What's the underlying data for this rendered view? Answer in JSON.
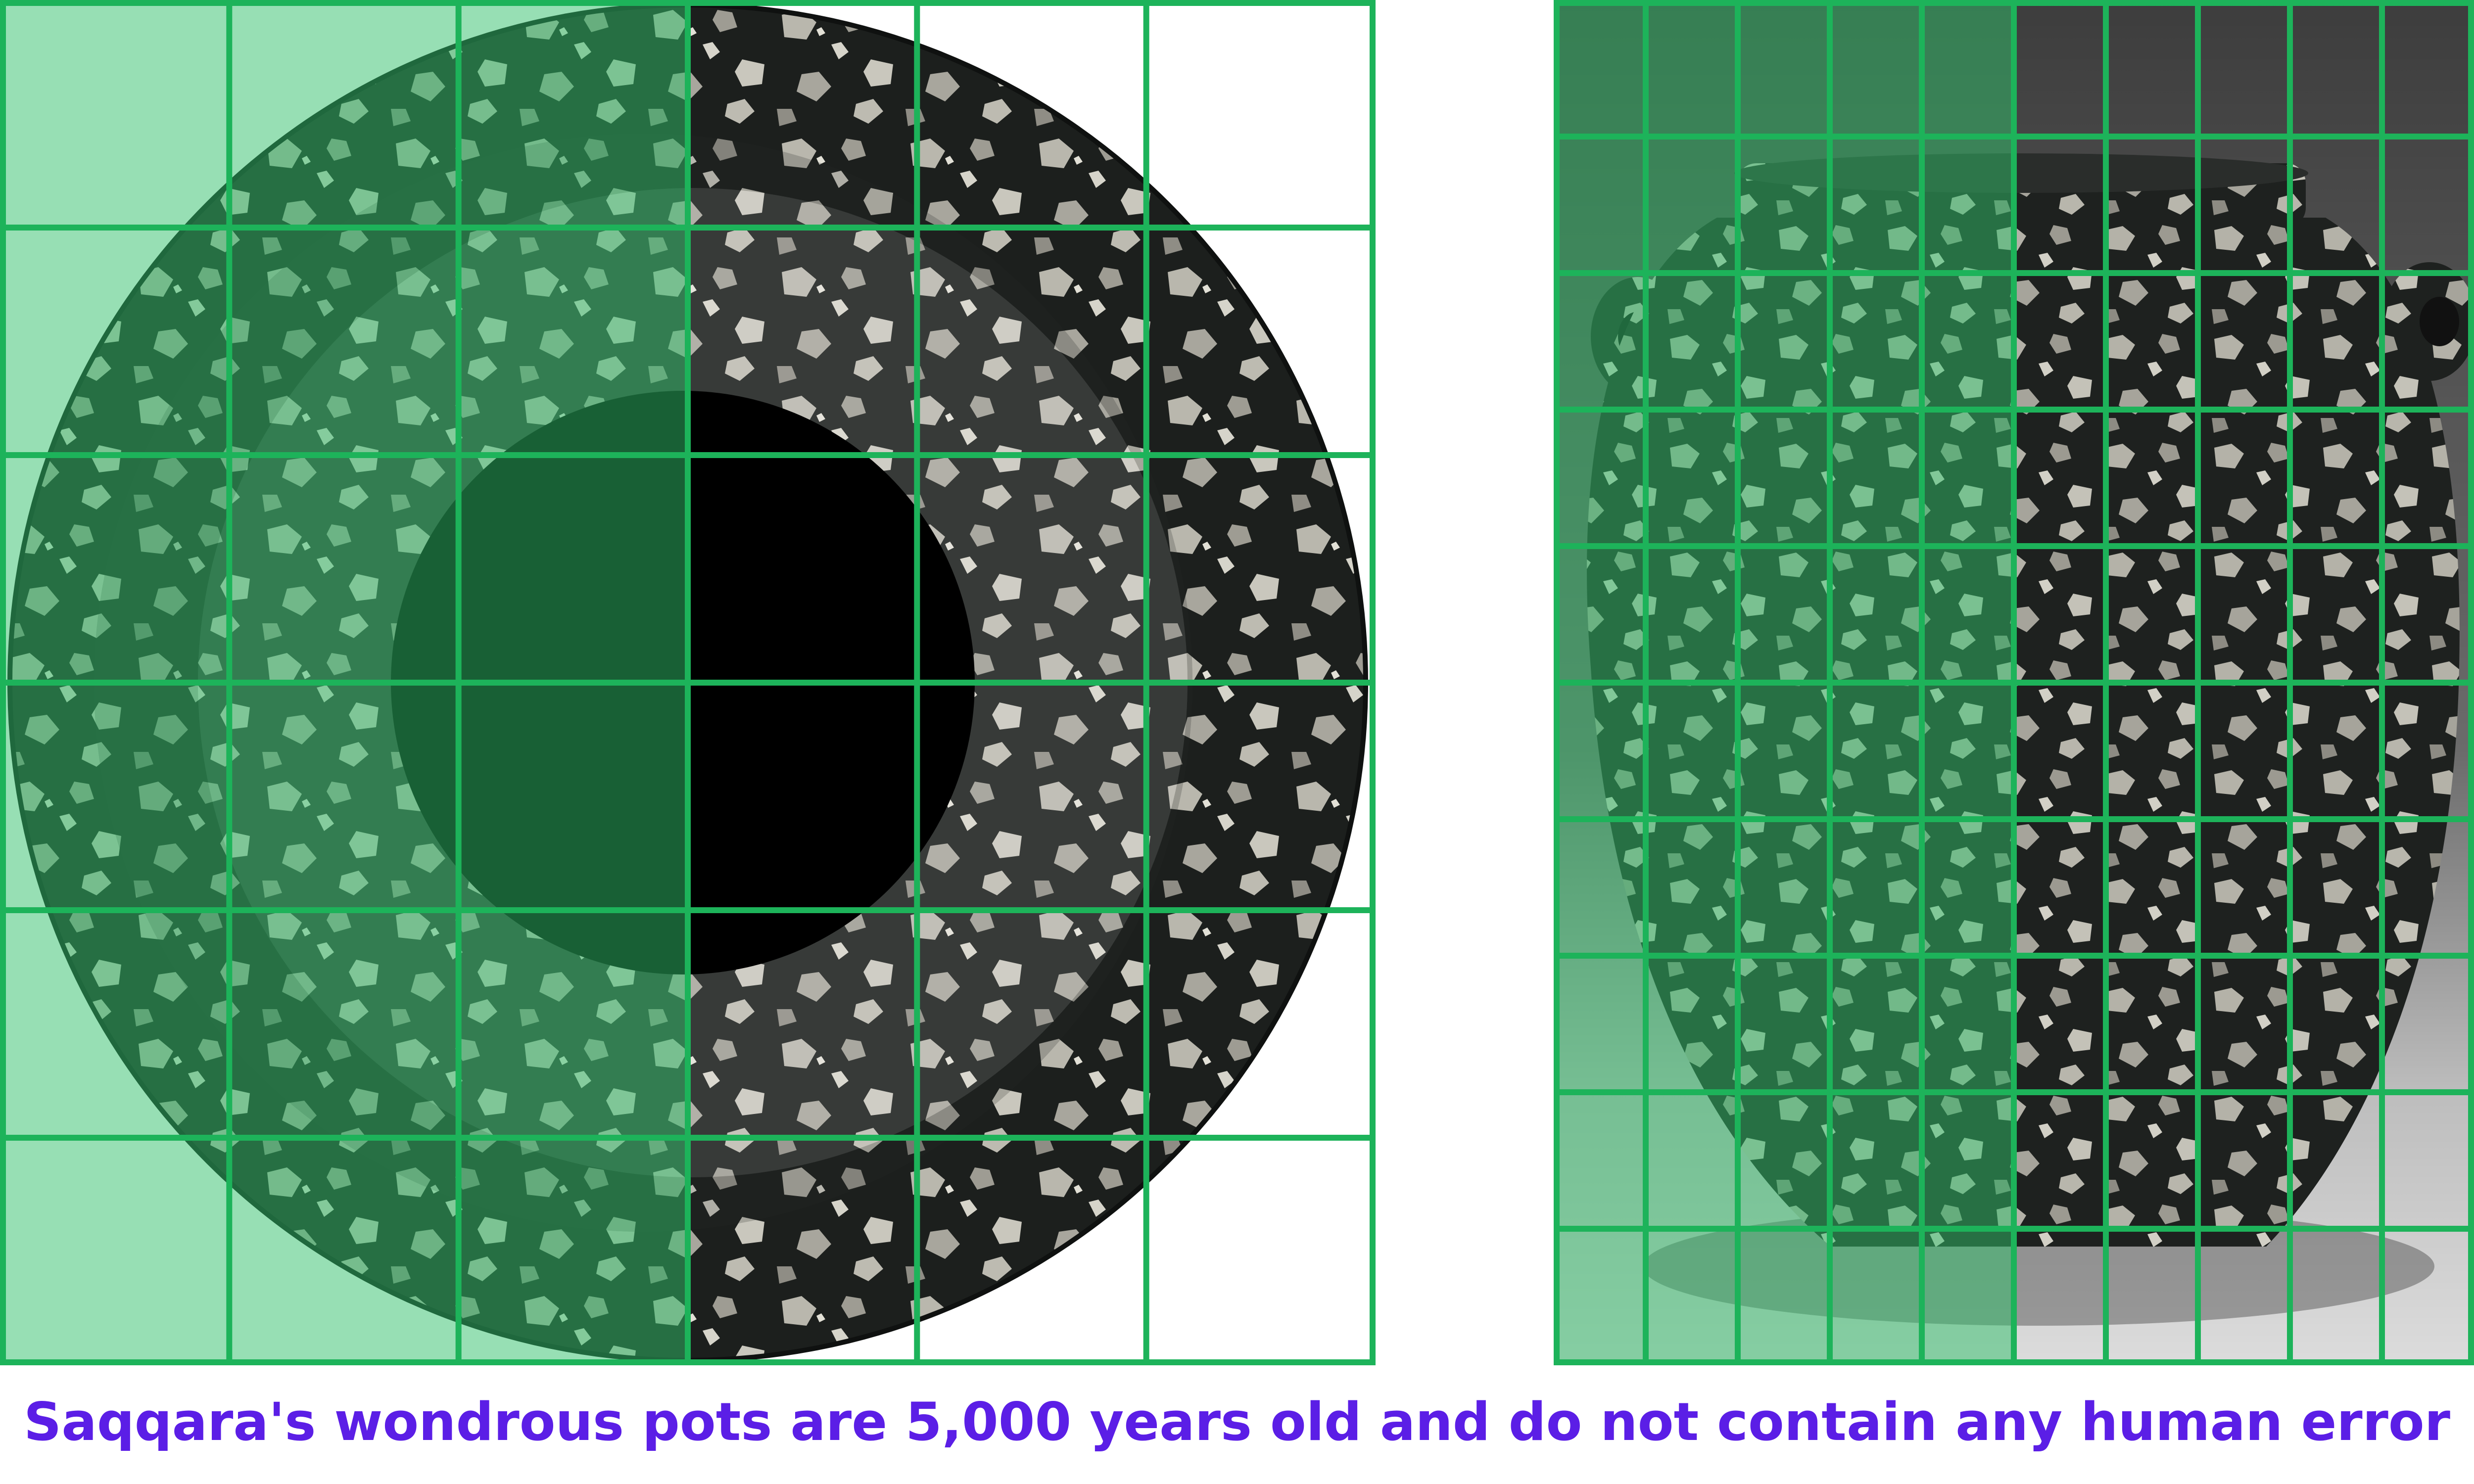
{
  "caption": {
    "text": "Saqqara's wondrous pots are 5,000 years old and do not contain any human error",
    "color": "#5b1ee6"
  },
  "colors": {
    "grid_line": "#1db35a",
    "overlay_tint": "#2fbf6a",
    "stone_dark": "#1c1f1d",
    "stone_light": "#b9b7ad",
    "background_gray": "#4a4a4a"
  },
  "left_panel": {
    "subject": "stone bowl viewed from above",
    "grid": {
      "columns": 6,
      "rows": 6
    },
    "overlay_fraction": 0.5
  },
  "right_panel": {
    "subject": "stone jar viewed from the side",
    "grid": {
      "columns": 10,
      "rows": 10
    },
    "overlay_fraction": 0.5
  }
}
